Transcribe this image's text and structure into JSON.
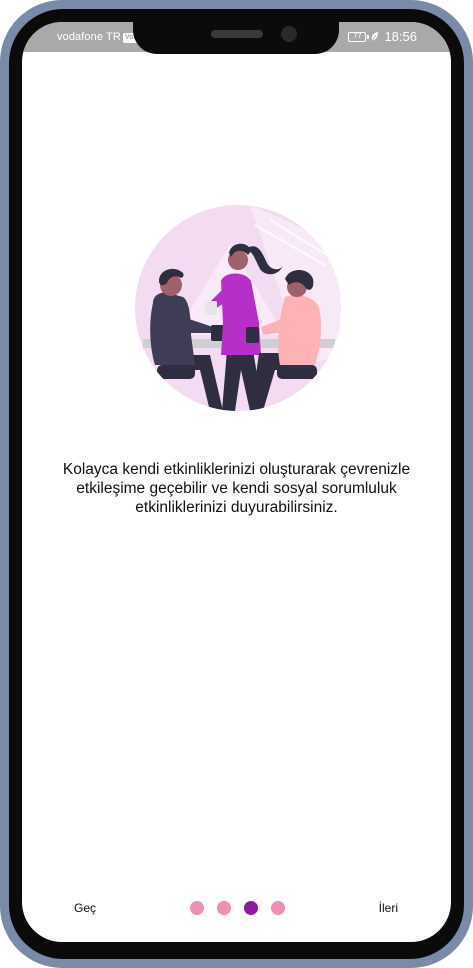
{
  "status_bar": {
    "carrier": "vodafone TR",
    "network_badge": "VoLTE",
    "battery": "77",
    "time": "18:56",
    "icons": [
      "battery-icon",
      "leaf-icon"
    ]
  },
  "onboarding": {
    "illustration": "friends-meeting-illustration",
    "description_lines": [
      "Kolayca kendi etkinliklerinizi oluşturarak çevrenizle",
      "etkileşime geçebilir ve kendi sosyal sorumluluk",
      "etkinliklerinizi duyurabilirsiniz."
    ]
  },
  "footer": {
    "skip_label": "Geç",
    "next_label": "İleri",
    "page_count": 4,
    "active_page": 3
  },
  "colors": {
    "dot_inactive": "#ee8fb4",
    "dot_active": "#8e1aa0",
    "illustration_bg": "#f3dcf2",
    "accent_purple": "#b52fc8"
  }
}
